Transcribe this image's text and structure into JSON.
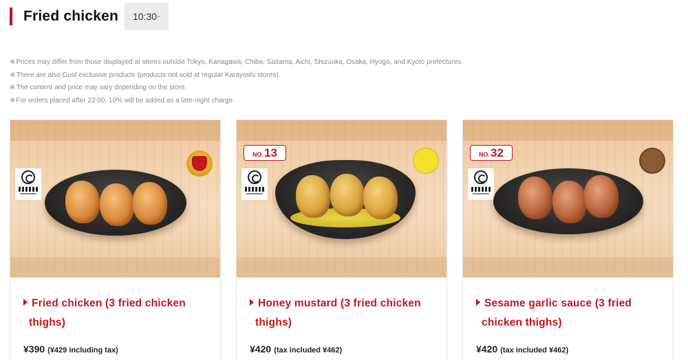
{
  "header": {
    "title": "Fried chicken",
    "time": "10:30",
    "time_suffix": "~"
  },
  "notes": {
    "mark": "※",
    "items": [
      "Prices may differ from those displayed at stores outside Tokyo, Kanagawa, Chiba, Saitama, Aichi, Shizuoka, Osaka, Hyogo, and Kyoto prefectures.",
      "There are also Gust exclusive products (products not sold at regular Karayoshi stores).",
      "The content and price may vary depending on the store.",
      "For orders placed after 22:00, 10% will be added as a late-night charge."
    ]
  },
  "products": [
    {
      "name_line1": "Fried chicken (3 fried chicken",
      "name_line2": "thighs)",
      "price": "¥390",
      "tax": "(¥429 including tax)",
      "rank_no": "",
      "rank_num": "",
      "badge": "award-medal-icon"
    },
    {
      "name_line1": "Honey mustard (3 fried chicken",
      "name_line2": "thighs)",
      "price": "¥420",
      "tax": "(tax included ¥462)",
      "rank_no": "NO.",
      "rank_num": "13",
      "badge": "honey-mustard-badge"
    },
    {
      "name_line1": "Sesame garlic sauce (3 fried",
      "name_line2": "chicken thighs)",
      "price": "¥420",
      "tax": "(tax included ¥462)",
      "rank_no": "NO.",
      "rank_num": "32",
      "badge": "garlic-sauce-badge"
    }
  ],
  "colors": {
    "accent": "#c4161c",
    "header_bar": "#b8172a",
    "note_text": "#8a8a8a",
    "time_badge_bg": "#ececec"
  }
}
